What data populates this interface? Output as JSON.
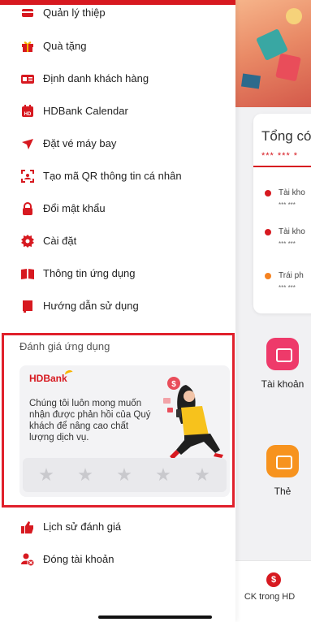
{
  "menu": [
    {
      "label": "Quản lý thiệp",
      "icon": "card-icon"
    },
    {
      "label": "Quà tặng",
      "icon": "gift-icon"
    },
    {
      "label": "Định danh khách hàng",
      "icon": "id-card-icon"
    },
    {
      "label": "HDBank Calendar",
      "icon": "calendar-icon"
    },
    {
      "label": "Đặt vé máy bay",
      "icon": "airplane-icon"
    },
    {
      "label": "Tạo mã QR thông tin cá nhân",
      "icon": "qr-code-icon"
    },
    {
      "label": "Đổi mật khẩu",
      "icon": "lock-icon"
    },
    {
      "label": "Cài đặt",
      "icon": "gear-icon"
    },
    {
      "label": "Thông tin ứng dụng",
      "icon": "book-icon"
    },
    {
      "label": "Hướng dẫn sử dụng",
      "icon": "flag-icon"
    }
  ],
  "rating": {
    "title": "Đánh giá ứng dụng",
    "brand": "HDBank",
    "description": "Chúng tôi luôn mong muốn nhận được phản hồi của Quý khách để nâng cao chất lượng dịch vụ.",
    "stars": 5,
    "rating_value": 0
  },
  "menu_after": [
    {
      "label": "Lịch sử đánh giá",
      "icon": "thumbs-up-icon"
    },
    {
      "label": "Đóng tài khoản",
      "icon": "close-account-icon"
    }
  ],
  "background": {
    "balance_title": "Tổng có",
    "balance_mask": "*** *** *",
    "accounts": [
      {
        "label": "Tài kho",
        "mask": "*** ***",
        "color": "#d71920"
      },
      {
        "label": "Tài kho",
        "mask": "*** ***",
        "color": "#d71920"
      },
      {
        "label": "Trái ph",
        "mask": "*** ***",
        "color": "#f58220"
      }
    ],
    "quick_actions": [
      {
        "label": "Tài khoản",
        "color": "#ee3a6a"
      },
      {
        "label": "Thẻ",
        "color": "#f7931e"
      }
    ],
    "bottom_tab": {
      "label": "CK trong HD",
      "icon_glyph": "$"
    }
  },
  "colors": {
    "brand_red": "#d71920",
    "highlight_frame": "#e0202b",
    "star_gray": "#c9c9cd"
  }
}
